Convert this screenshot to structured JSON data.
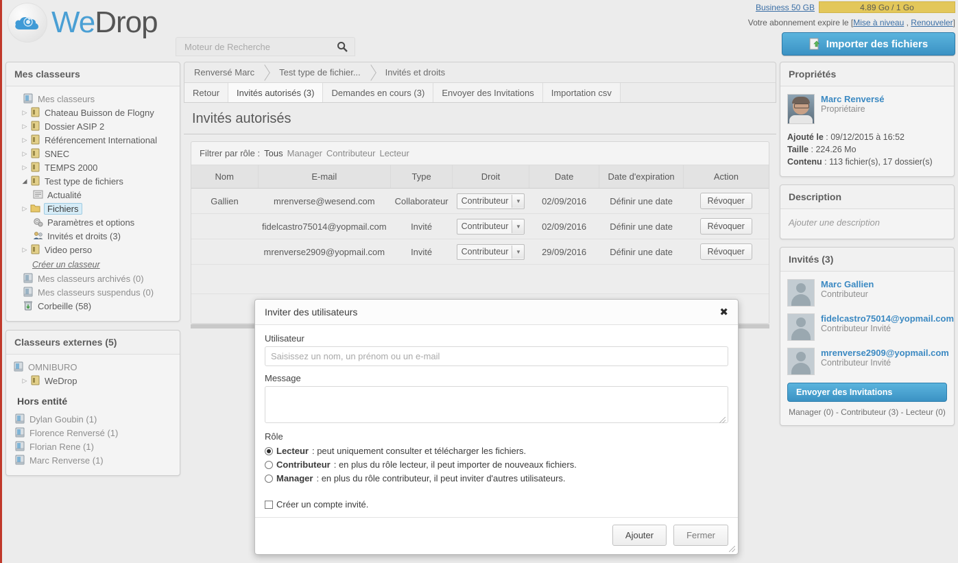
{
  "brand": {
    "we": "We",
    "drop": "Drop",
    "accent": "#4a9fd4"
  },
  "search": {
    "placeholder": "Moteur de Recherche",
    "value": ""
  },
  "account": {
    "plan": "Business 50 GB",
    "quota": "4.89 Go / 1 Go",
    "quota_color": "#e3c75a",
    "expire_text": "Votre abonnement expire le [",
    "upgrade_link": "Mise à niveau",
    "link_sep": " , ",
    "renew_link": "Renouveler",
    "expire_suffix": "]",
    "import_button": "Importer des fichiers"
  },
  "sidebar": {
    "title": "Mes classeurs",
    "root": "Mes classeurs",
    "folders": [
      {
        "label": "Chateau Buisson de Flogny",
        "expanded": false
      },
      {
        "label": "Dossier ASIP 2",
        "expanded": false
      },
      {
        "label": "Référencement International",
        "expanded": false
      },
      {
        "label": "SNEC",
        "expanded": false
      },
      {
        "label": "TEMPS 2000",
        "expanded": false
      },
      {
        "label": "Test type de fichiers",
        "expanded": true
      }
    ],
    "children": [
      {
        "label": "Actualité",
        "icon": "news-icon",
        "selected": false,
        "arrow": false
      },
      {
        "label": "Fichiers",
        "icon": "folder-icon",
        "selected": true,
        "arrow": true
      },
      {
        "label": "Paramètres et options",
        "icon": "gears-icon",
        "selected": false,
        "arrow": false
      },
      {
        "label": "Invités et droits (3)",
        "icon": "users-icon",
        "selected": false,
        "arrow": false
      }
    ],
    "last_folder": "Video perso",
    "create_link": "Créer un classeur",
    "archived": "Mes classeurs archivés (0)",
    "suspended": "Mes classeurs suspendus (0)",
    "trash": "Corbeille (58)",
    "external_title": "Classeurs externes (5)",
    "external_root": "OMNIBURO",
    "external_child": "WeDrop",
    "hors_title": "Hors entité",
    "hors_items": [
      "Dylan Goubin (1)",
      "Florence Renversé (1)",
      "Florian Rene (1)",
      "Marc Renverse (1)"
    ]
  },
  "breadcrumb": [
    "Renversé Marc",
    "Test type de fichier...",
    "Invités et droits"
  ],
  "tabs": [
    {
      "label": "Retour",
      "active": false
    },
    {
      "label": "Invités autorisés (3)",
      "active": true
    },
    {
      "label": "Demandes en cours (3)",
      "active": false
    },
    {
      "label": "Envoyer des Invitations",
      "active": false
    },
    {
      "label": "Importation csv",
      "active": false
    }
  ],
  "main": {
    "section_title": "Invités autorisés",
    "filter_label": "Filtrer par rôle :",
    "filters": [
      {
        "label": "Tous",
        "active": true
      },
      {
        "label": "Manager",
        "active": false
      },
      {
        "label": "Contributeur",
        "active": false
      },
      {
        "label": "Lecteur",
        "active": false
      }
    ],
    "columns": [
      "Nom",
      "E-mail",
      "Type",
      "Droit",
      "Date",
      "Date d'expiration",
      "Action"
    ],
    "rows": [
      {
        "nom": "Gallien",
        "email": "mrenverse@wesend.com",
        "type": "Collaborateur",
        "droit": "Contributeur",
        "date": "02/09/2016",
        "expiration": "Définir une date",
        "action": "Révoquer"
      },
      {
        "nom": "",
        "email": "fidelcastro75014@yopmail.com",
        "type": "Invité",
        "droit": "Contributeur",
        "date": "02/09/2016",
        "expiration": "Définir une date",
        "action": "Révoquer"
      },
      {
        "nom": "",
        "email": "mrenverse2909@yopmail.com",
        "type": "Invité",
        "droit": "Contributeur",
        "date": "29/09/2016",
        "expiration": "Définir une date",
        "action": "Révoquer"
      }
    ]
  },
  "properties": {
    "title": "Propriétés",
    "owner_name": "Marc Renversé",
    "owner_role": "Propriétaire",
    "added_label": "Ajouté le",
    "added_value": ": 09/12/2015 à 16:52",
    "size_label": "Taille",
    "size_value": ": 224.26 Mo",
    "content_label": "Contenu",
    "content_value": ": 113 fichier(s), 17 dossier(s)"
  },
  "description": {
    "title": "Description",
    "placeholder": "Ajouter une description"
  },
  "guests": {
    "title": "Invités (3)",
    "items": [
      {
        "name": "Marc Gallien",
        "role": "Contributeur"
      },
      {
        "name": "fidelcastro75014@yopmail.com",
        "role": "Contributeur Invité"
      },
      {
        "name": "mrenverse2909@yopmail.com",
        "role": "Contributeur Invité"
      }
    ],
    "invite_button": "Envoyer des Invitations",
    "roles_summary": "Manager (0) - Contributeur (3) - Lecteur (0)"
  },
  "modal": {
    "title": "Inviter des utilisateurs",
    "close": "✖",
    "user_label": "Utilisateur",
    "user_placeholder": "Saisissez un nom, un prénom ou un e-mail",
    "user_value": "",
    "message_label": "Message",
    "message_value": "",
    "role_label": "Rôle",
    "roles": [
      {
        "name": "Lecteur",
        "desc": " : peut uniquement consulter et télécharger les fichiers.",
        "checked": true
      },
      {
        "name": "Contributeur",
        "desc": " : en plus du rôle lecteur, il peut importer de nouveaux fichiers.",
        "checked": false
      },
      {
        "name": "Manager",
        "desc": " : en plus du rôle contributeur, il peut inviter d'autres utilisateurs.",
        "checked": false
      }
    ],
    "guest_account_label": "Créer un compte invité.",
    "guest_account_checked": false,
    "submit": "Ajouter",
    "cancel": "Fermer"
  }
}
